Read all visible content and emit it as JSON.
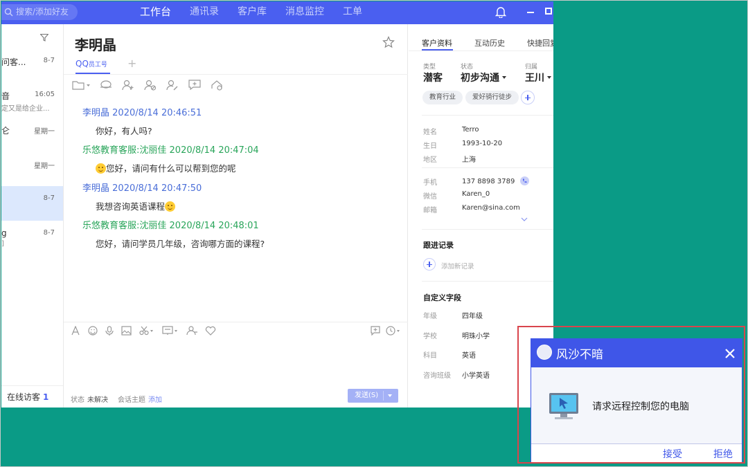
{
  "topbar": {
    "search_placeholder": "搜索/添加好友",
    "nav": [
      {
        "label": "工作台",
        "active": true
      },
      {
        "label": "通讯录",
        "active": false
      },
      {
        "label": "客户库",
        "active": false
      },
      {
        "label": "消息监控",
        "active": false
      },
      {
        "label": "工单",
        "active": false
      }
    ]
  },
  "conversations": [
    {
      "name": "问客...",
      "time": "8-7",
      "preview": ""
    },
    {
      "name": "音",
      "time": "16:05",
      "preview": "定又是给企业..."
    },
    {
      "name": "仑",
      "time": "星期一",
      "preview": ""
    },
    {
      "name": "",
      "time": "星期一",
      "preview": ""
    },
    {
      "name": "",
      "time": "8-7",
      "preview": "",
      "active": true
    },
    {
      "name": "g",
      "time": "8-7",
      "preview": "]"
    }
  ],
  "online": {
    "label": "在线访客",
    "count": "1"
  },
  "chat": {
    "contact_name": "李明晶",
    "tab_label": "QQ",
    "tab_sub": "员工号",
    "messages": [
      {
        "sender": "李明晶",
        "time": "2020/8/14 20:46:51",
        "role": "customer",
        "text": "你好，有人吗?",
        "emoji": ""
      },
      {
        "sender": "乐悠教育客服:沈丽佳",
        "time": "2020/8/14 20:47:04",
        "role": "agent",
        "text": "您好，请问有什么可以帮到您的呢",
        "emoji": "smile-emoji-before"
      },
      {
        "sender": "李明晶",
        "time": "2020/8/14 20:47:50",
        "role": "customer",
        "text": "我想咨询英语课程",
        "emoji": "thinking-emoji-after"
      },
      {
        "sender": "乐悠教育客服:沈丽佳",
        "time": "2020/8/14 20:48:01",
        "role": "agent",
        "text": "您好，请问学员几年级，咨询哪方面的课程?",
        "emoji": ""
      }
    ],
    "status_label": "状态",
    "status_value": "未解决",
    "topic_label": "会话主题",
    "topic_add": "添加",
    "send_label": "发送(S)"
  },
  "panel": {
    "tabs": [
      "客户资料",
      "互动历史",
      "快捷回复"
    ],
    "type_label": "类型",
    "type_value": "潜客",
    "state_label": "状态",
    "state_value": "初步沟通",
    "owner_label": "归属",
    "owner_value": "王川",
    "tags": [
      "教育行业",
      "爱好骑行徒步"
    ],
    "info": [
      {
        "label": "姓名",
        "value": "Terro"
      },
      {
        "label": "生日",
        "value": "1993-10-20"
      },
      {
        "label": "地区",
        "value": "上海"
      },
      {
        "label": "手机",
        "value": "137 8898 3789"
      },
      {
        "label": "微信",
        "value": "Karen_0"
      },
      {
        "label": "邮箱",
        "value": "Karen@sina.com"
      }
    ],
    "follow_title": "跟进记录",
    "add_record": "添加新记录",
    "custom_title": "自定义字段",
    "custom": [
      {
        "label": "年级",
        "value": "四年级"
      },
      {
        "label": "学校",
        "value": "明珠小学"
      },
      {
        "label": "科目",
        "value": "英语"
      },
      {
        "label": "咨询班级",
        "value": "小学英语"
      }
    ]
  },
  "popup": {
    "title": "风沙不暗",
    "message": "请求远程控制您的电脑",
    "accept": "接受",
    "reject": "拒绝"
  },
  "colors": {
    "brand": "#4a5ff0",
    "desktop": "#0a9b86",
    "agent_text": "#29a55a",
    "customer_text": "#4a6ed8",
    "highlight_box": "#d9454c"
  }
}
